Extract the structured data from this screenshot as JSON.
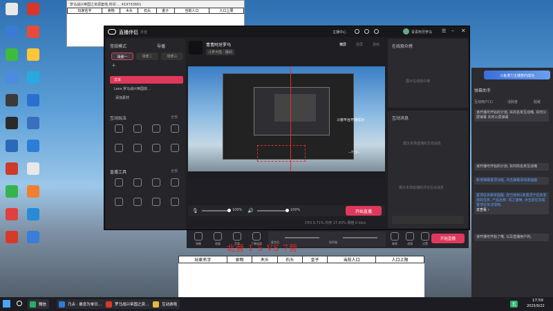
{
  "desktop": {
    "icons_left": [
      {
        "label": "",
        "color": "#e8e8e8"
      },
      {
        "label": "",
        "color": "#3a7bd5"
      },
      {
        "label": "",
        "color": "#3dbb3d"
      },
      {
        "label": "",
        "color": "#4c8be0"
      },
      {
        "label": "",
        "color": "#3a3a3a"
      },
      {
        "label": "",
        "color": "#2a2a2a"
      },
      {
        "label": "",
        "color": "#2a6ab8"
      },
      {
        "label": "",
        "color": "#cc3a2a"
      },
      {
        "label": "",
        "color": "#36b34a"
      },
      {
        "label": "",
        "color": "#e04040"
      },
      {
        "label": "",
        "color": "#d83a2a"
      }
    ],
    "icons_right": [
      {
        "label": "",
        "color": "#d8362a"
      },
      {
        "label": "",
        "color": "#e84a3a"
      },
      {
        "label": "",
        "color": "#ffc637"
      },
      {
        "label": "",
        "color": "#2aa8e0"
      },
      {
        "label": "",
        "color": "#2a6fd0"
      },
      {
        "label": "",
        "color": "#3a6fc0"
      },
      {
        "label": "",
        "color": "#2a7ed8"
      },
      {
        "label": "",
        "color": "#e8e8e8"
      },
      {
        "label": "",
        "color": "#f08030"
      },
      {
        "label": "",
        "color": "#2a8ad8"
      },
      {
        "label": "",
        "color": "#3a7ed8"
      }
    ]
  },
  "top_table": {
    "title": "罗马战兴帝国之资源套塔,时间 … 419733661",
    "headers": [
      "玩家名字",
      "食物",
      "木头",
      "石头",
      "金子",
      "当前人口",
      "人口上限"
    ]
  },
  "main": {
    "app_name": "直播伴侣",
    "app_sub": "抖音",
    "mode_label": "常规模式",
    "import_label": "导播",
    "scene_tabs": [
      "场景一",
      "场景二",
      "场景三"
    ],
    "sources": [
      "文本",
      "Leos 罗马战兴帝国放..."
    ],
    "add_source": "添加素材",
    "interaction_title": "互动玩法",
    "interaction_all": "全部",
    "interaction_tools": [
      "",
      "",
      "",
      "",
      "",
      "",
      "",
      ""
    ],
    "live_tools_title": "直播工具",
    "live_tools_all": "全部",
    "live_tools": [
      "",
      "",
      "",
      "",
      "",
      "",
      "",
      ""
    ],
    "streamer_name": "青青阿牙罗马",
    "streamer_tag": "斗罗大陆 · 播间",
    "orient": [
      "横屏",
      "竖屏",
      "游戏"
    ],
    "top_buttons": [
      "主播中心"
    ],
    "account_name": "青青阿牙罗马",
    "overlay_text": "斗兽平台开播成功",
    "overlay_text2": "--772--",
    "mic_pct": "100%",
    "spk_pct": "100%",
    "start_live": "开始直播",
    "stats": "CPU 0.71%  内存 17.43%  网络 0 kb/s",
    "audience_title": "在线观众榜",
    "audience_empty": "展示在线观众榜",
    "interaction_msgs_title": "互动消息",
    "interaction_msgs_empty": "展示本场直播的互动消息",
    "interaction_msgs_empty2": "展示本场直播的评论互动消息"
  },
  "bottom_bar": {
    "tools": [
      "弹幕",
      "观看",
      "音频",
      "下播画面"
    ],
    "mic_label": "麦克风",
    "spk_label": "扬声器",
    "right_tools": [
      "美颜",
      "滤镜",
      "设置"
    ],
    "start_live": "开始直播"
  },
  "right_panel": {
    "banner": "斗鱼潜力主播签约成功",
    "title": "弹幕助手",
    "tabs": [
      "互动用户(1)",
      "活跃度",
      "贴纸"
    ],
    "msg1": "该开播可开始的计划, 实的名单互动哦, 实时公屏弹幕 实时公屏弹幕",
    "msg2": "该开播可开始的计划, 实时的名单互动哦",
    "msg3": "新增弹幕置顶功能, 点击弹幕添加进画面",
    "msg4": "置顶任务做单提醒: 您已收到1条置顶于任务发放的任务, 产品名称: 风之旋律, 点击前往完成置顶任务详情吧。",
    "msg4_link": "去查看 ›",
    "msg5": "该开播可开始了哦, 以及直播用户的。"
  },
  "score_text": "北营 1 5 VS 7营",
  "bottom_table": {
    "headers": [
      "玩家名字",
      "食物",
      "木头",
      "石头",
      "金子",
      "当前人口",
      "人口上限"
    ]
  },
  "taskbar": {
    "apps": [
      {
        "label": "微信",
        "color": "#2aae67"
      },
      {
        "label": "乃古 · 悬念为单日…",
        "color": "#2a7ed8"
      },
      {
        "label": "罗马战兴帝国之资…",
        "color": "#d83a2a"
      },
      {
        "label": "互动游戏",
        "color": "#e8b93a"
      }
    ],
    "ime": "五",
    "time": "17:59",
    "date": "2025/9/22"
  }
}
